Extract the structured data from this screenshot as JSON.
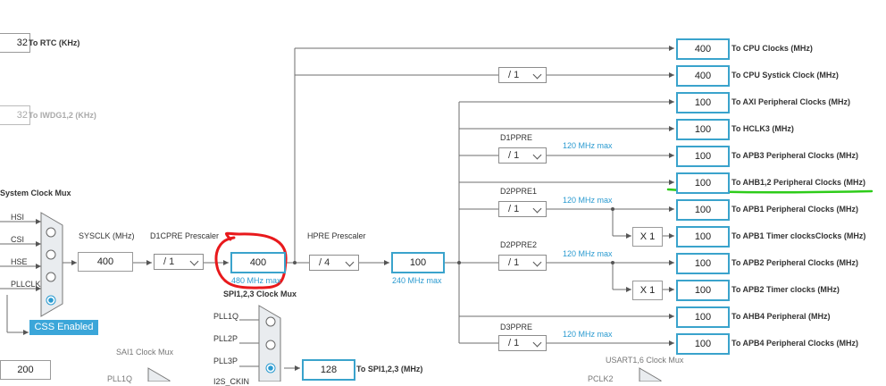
{
  "outputs": [
    {
      "id": "cpu",
      "value": "400",
      "label": "To CPU Clocks (MHz)"
    },
    {
      "id": "systick",
      "value": "400",
      "label": "To CPU Systick Clock (MHz)"
    },
    {
      "id": "axi",
      "value": "100",
      "label": "To AXI Peripheral Clocks (MHz)"
    },
    {
      "id": "hclk3",
      "value": "100",
      "label": "To HCLK3 (MHz)"
    },
    {
      "id": "apb3",
      "value": "100",
      "label": "To APB3 Peripheral Clocks (MHz)"
    },
    {
      "id": "ahb12",
      "value": "100",
      "label": "To AHB1,2 Peripheral Clocks (MHz)"
    },
    {
      "id": "apb1",
      "value": "100",
      "label": "To APB1 Peripheral Clocks (MHz)"
    },
    {
      "id": "apb1t",
      "value": "100",
      "label": "To APB1 Timer clocksClocks (MHz)"
    },
    {
      "id": "apb2",
      "value": "100",
      "label": "To APB2 Peripheral Clocks (MHz)"
    },
    {
      "id": "apb2t",
      "value": "100",
      "label": "To APB2 Timer clocks (MHz)"
    },
    {
      "id": "ahb4",
      "value": "100",
      "label": "To AHB4 Peripheral (MHz)"
    },
    {
      "id": "apb4",
      "value": "100",
      "label": "To APB4 Peripheral Clocks (MHz)"
    }
  ],
  "left": {
    "rtc_value": "32",
    "rtc_label": "To RTC (KHz)",
    "iwdg_value": "32",
    "iwdg_label": "To IWDG1,2 (KHz)",
    "sysclk_mux_label": "System Clock Mux",
    "mux_inputs": [
      "HSI",
      "CSI",
      "HSE",
      "PLLCLK"
    ],
    "css_button": "CSS Enabled",
    "sysclk_label": "SYSCLK (MHz)",
    "sysclk_value": "400",
    "d1cpre_label": "D1CPRE Prescaler",
    "d1cpre_value": "/ 1",
    "core_value": "400",
    "core_max": "480 MHz max",
    "hpre_label": "HPRE Prescaler",
    "hpre_value": "/ 4",
    "hclk_value": "100",
    "hclk_max": "240 MHz max",
    "bottom_value": "200",
    "sai1_label": "SAI1 Clock Mux",
    "pll1q": "PLL1Q"
  },
  "center": {
    "systick_div": "/ 1",
    "d1ppre_label": "D1PPRE",
    "d1ppre_value": "/ 1",
    "d1ppre_max": "120 MHz max",
    "d2ppre1_label": "D2PPRE1",
    "d2ppre1_value": "/ 1",
    "d2ppre1_max": "120 MHz max",
    "d2ppre2_label": "D2PPRE2",
    "d2ppre2_value": "/ 1",
    "d2ppre2_max": "120 MHz max",
    "d3ppre_label": "D3PPRE",
    "d3ppre_value": "/ 1",
    "d3ppre_max": "120 MHz max",
    "x1a": "X 1",
    "x1b": "X 1"
  },
  "spi": {
    "mux_label": "SPI1,2,3 Clock Mux",
    "inputs": [
      "PLL1Q",
      "PLL2P",
      "PLL3P",
      "I2S_CKIN"
    ],
    "value": "128",
    "out_label": "To SPI1,2,3 (MHz)"
  },
  "usart": {
    "mux_label": "USART1,6 Clock Mux",
    "pclk2": "PCLK2"
  },
  "colors": {
    "accent": "#3aa3cc",
    "annotation_red": "#e8191c",
    "annotation_green": "#2ecc1a",
    "button": "#3ba6d9"
  }
}
